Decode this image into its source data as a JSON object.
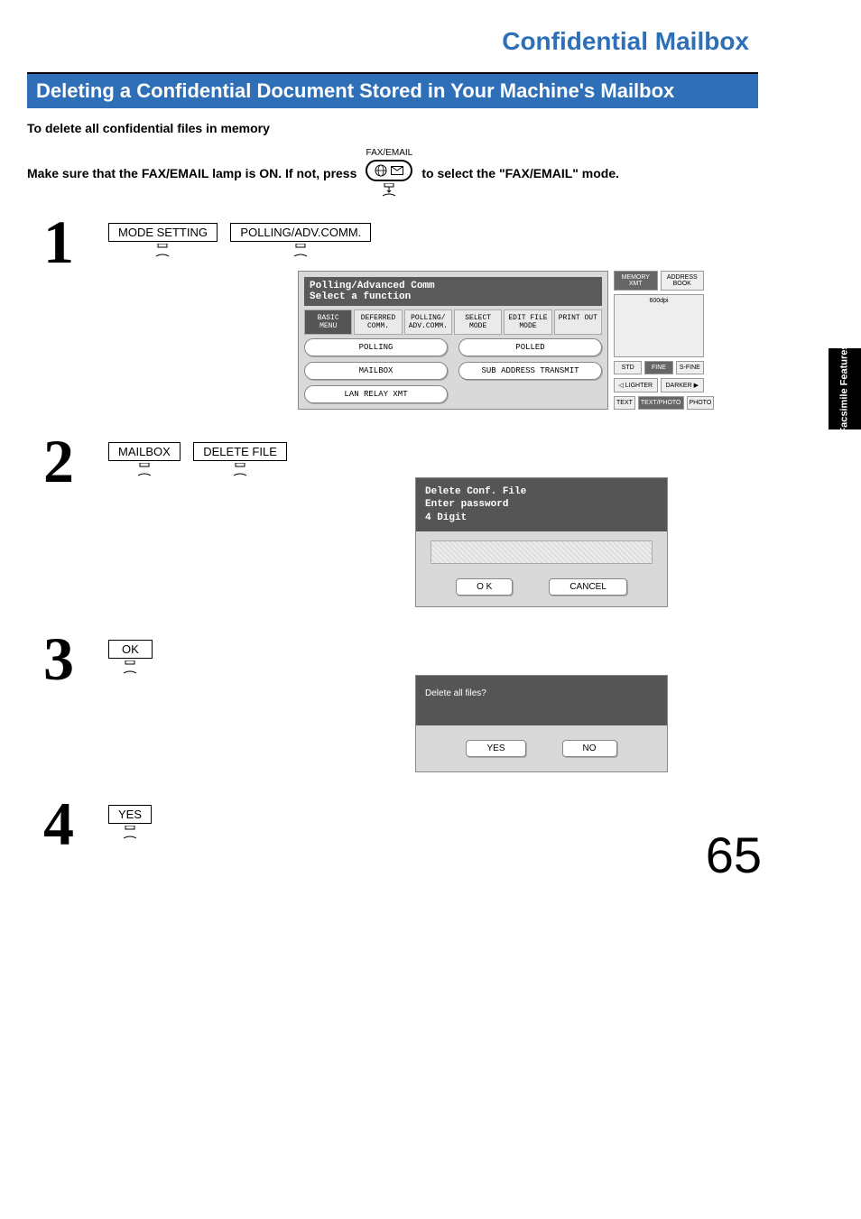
{
  "page_number": "65",
  "side_tab": "Facsimile\nFeatures",
  "section_title": "Confidential Mailbox",
  "subheader": "Deleting a Confidential Document Stored in Your Machine's Mailbox",
  "intro1": "To delete all confidential files in memory",
  "intro_pre": "Make sure that the FAX/EMAIL lamp is ON.  If not, press",
  "intro_post": " to select the \"FAX/EMAIL\" mode.",
  "fax_email_label": "FAX/EMAIL",
  "steps": {
    "s1": {
      "num": "1",
      "btn1": "MODE SETTING",
      "btn2": "POLLING/ADV.COMM."
    },
    "s2": {
      "num": "2",
      "btn1": "MAILBOX",
      "btn2": "DELETE FILE"
    },
    "s3": {
      "num": "3",
      "btn1": "OK"
    },
    "s4": {
      "num": "4",
      "btn1": "YES"
    }
  },
  "screen1": {
    "title1": "Polling/Advanced Comm",
    "title2": "Select a function",
    "tabs": {
      "t1": "BASIC MENU",
      "t2": "DEFERRED COMM.",
      "t3": "POLLING/ ADV.COMM.",
      "t4": "SELECT MODE",
      "t5": "EDIT FILE MODE",
      "t6": "PRINT OUT"
    },
    "funcs": {
      "f1": "POLLING",
      "f2": "POLLED",
      "f3": "MAILBOX",
      "f4": "SUB ADDRESS TRANSMIT",
      "f5": "LAN RELAY XMT"
    },
    "side": {
      "memxmt": "MEMORY XMT",
      "addr": "ADDRESS BOOK",
      "dpi": "600dpi",
      "std": "STD",
      "fine": "FINE",
      "sfine": "S-FINE",
      "lighter": "LIGHTER",
      "darker": "DARKER",
      "text": "TEXT",
      "tp": "TEXT/PHOTO",
      "photo": "PHOTO"
    }
  },
  "screen2": {
    "l1": "Delete Conf. File",
    "l2": "Enter password",
    "l3": "4 Digit",
    "ok": "O K",
    "cancel": "CANCEL"
  },
  "screen3": {
    "prompt": "Delete all files?",
    "yes": "YES",
    "no": "NO"
  }
}
